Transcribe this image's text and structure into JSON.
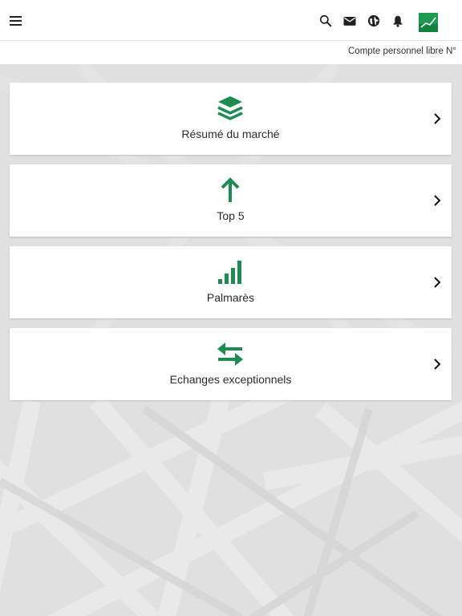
{
  "header": {
    "menu_icon": "hamburger-menu-icon",
    "icons": [
      "search-icon",
      "mail-icon",
      "globe-icon",
      "bell-icon"
    ],
    "logo_icon": "chart-logo-icon"
  },
  "account": {
    "label": "Compte personnel libre N°"
  },
  "menu": {
    "items": [
      {
        "label": "Résumé du marché",
        "icon": "layers-icon"
      },
      {
        "label": "Top 5",
        "icon": "arrow-up-icon"
      },
      {
        "label": "Palmarès",
        "icon": "signal-bars-icon"
      },
      {
        "label": "Echanges exceptionnels",
        "icon": "swap-arrows-icon"
      }
    ]
  },
  "colors": {
    "accent": "#1e8c52",
    "background": "#e2e3e2",
    "text": "#2b2b2b"
  }
}
